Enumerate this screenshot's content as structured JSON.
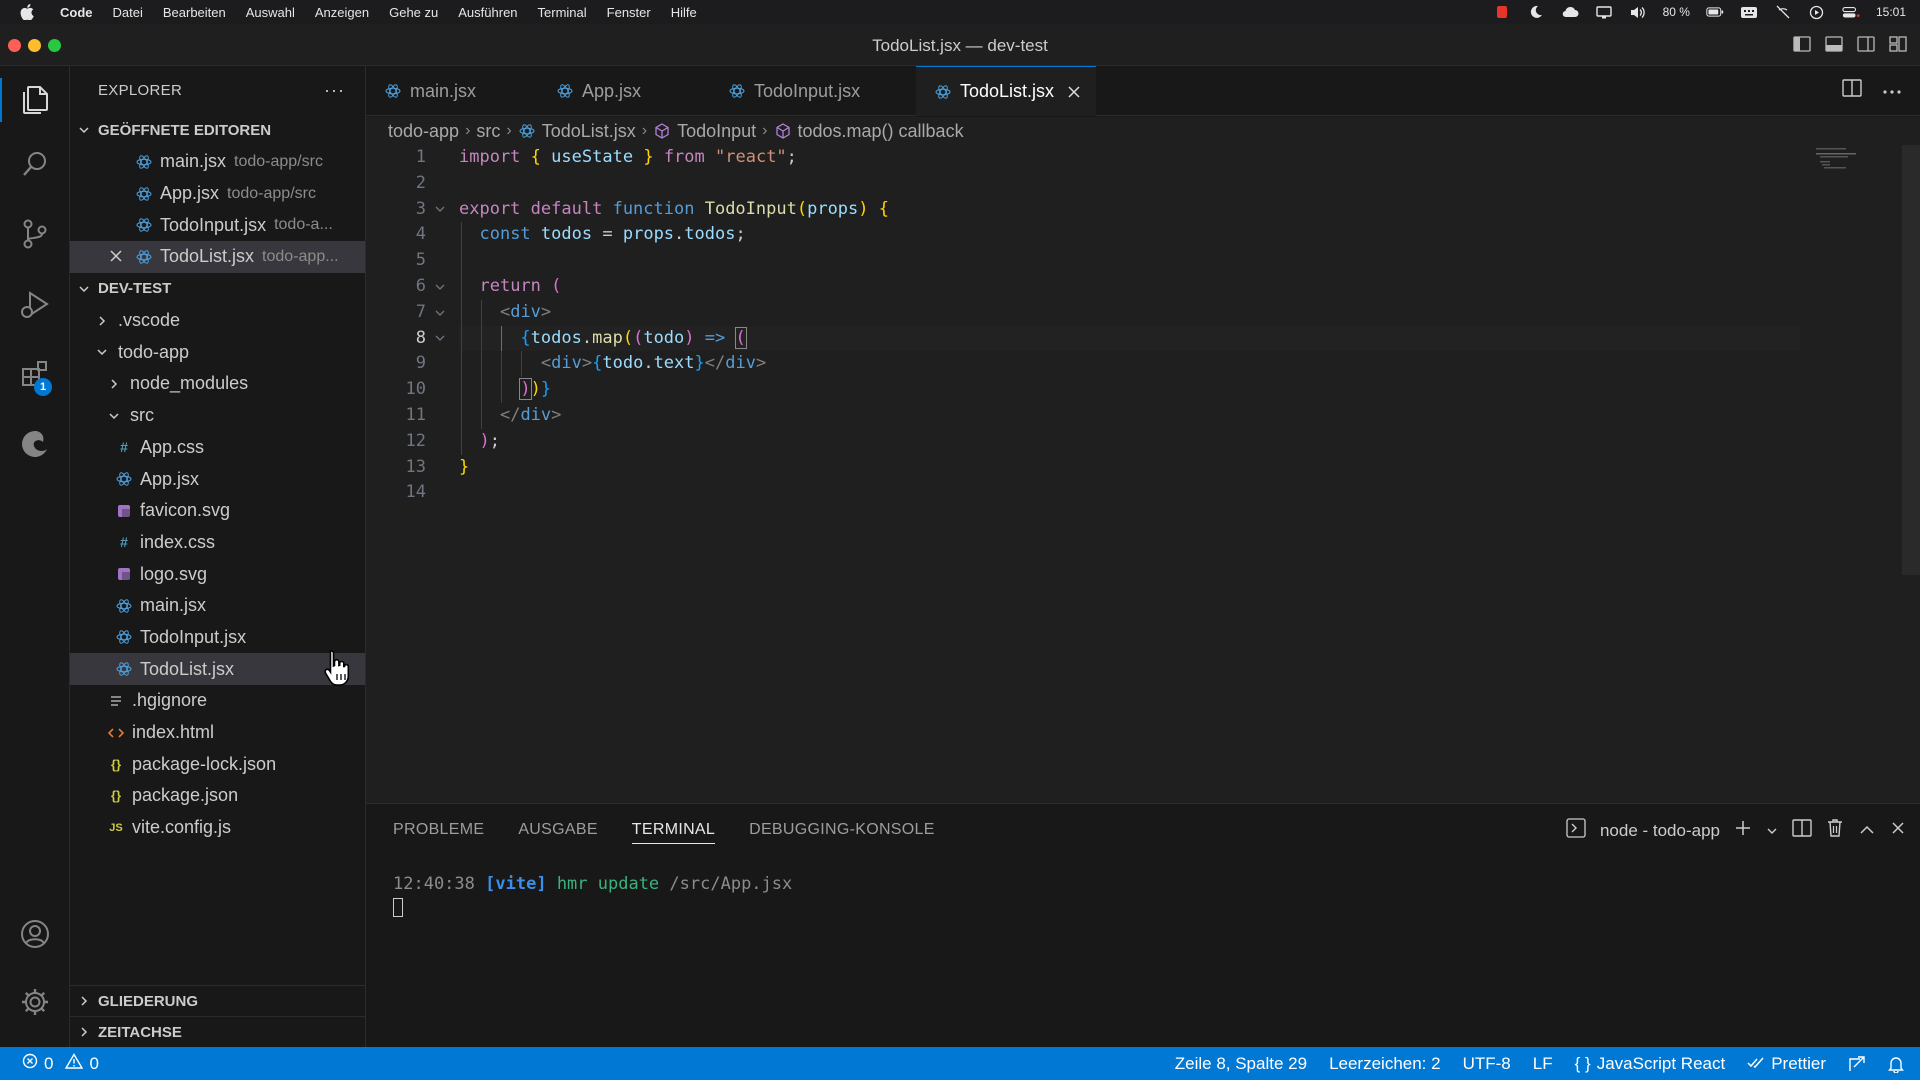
{
  "menubar": {
    "items": [
      "Code",
      "Datei",
      "Bearbeiten",
      "Auswahl",
      "Anzeigen",
      "Gehe zu",
      "Ausführen",
      "Terminal",
      "Fenster",
      "Hilfe"
    ],
    "battery": "80 %",
    "time": "15:01"
  },
  "window": {
    "title": "TodoList.jsx — dev-test"
  },
  "activity": {
    "extensions_badge": "1"
  },
  "sidebar": {
    "title": "EXPLORER",
    "more": "···",
    "open_editors": {
      "label": "GEÖFFNETE EDITOREN",
      "items": [
        {
          "name": "main.jsx",
          "path": "todo-app/src"
        },
        {
          "name": "App.jsx",
          "path": "todo-app/src"
        },
        {
          "name": "TodoInput.jsx",
          "path": "todo-a..."
        },
        {
          "name": "TodoList.jsx",
          "path": "todo-app..."
        }
      ]
    },
    "workspace": {
      "label": "DEV-TEST",
      "items": {
        "vscode": ".vscode",
        "todo_app": "todo-app",
        "node_modules": "node_modules",
        "src": "src",
        "app_css": "App.css",
        "app_jsx": "App.jsx",
        "favicon": "favicon.svg",
        "index_css": "index.css",
        "logo": "logo.svg",
        "main": "main.jsx",
        "todoinput": "TodoInput.jsx",
        "todolist": "TodoList.jsx",
        "hgignore": ".hgignore",
        "index_html": "index.html",
        "package_lock": "package-lock.json",
        "package": "package.json",
        "vite_config": "vite.config.js"
      }
    },
    "outline": "GLIEDERUNG",
    "timeline": "ZEITACHSE"
  },
  "tabs": [
    "main.jsx",
    "App.jsx",
    "TodoInput.jsx",
    "TodoList.jsx"
  ],
  "breadcrumb": [
    "todo-app",
    "src",
    "TodoList.jsx",
    "TodoInput",
    "todos.map() callback"
  ],
  "editor": {
    "line_numbers": [
      "1",
      "2",
      "3",
      "4",
      "5",
      "6",
      "7",
      "8",
      "9",
      "10",
      "11",
      "12",
      "13",
      "14"
    ],
    "tokens": {
      "import": "import",
      "lbrace": "{",
      "useState": "useState",
      "rbrace": "}",
      "from": "from",
      "react": "\"react\"",
      "semi": ";",
      "export": "export",
      "default": "default",
      "function": "function",
      "TodoInput": "TodoInput",
      "lparen": "(",
      "props": "props",
      "rparen": ")",
      "const": "const",
      "todos": "todos",
      "eq": "=",
      "dot": ".",
      "return": "return",
      "div_open": "div",
      "lt": "<",
      "gt": ">",
      "lt_slash": "</",
      "map": "map",
      "todo": "todo",
      "arrow": "=>",
      "text": "text"
    }
  },
  "panel": {
    "tabs": [
      "PROBLEME",
      "AUSGABE",
      "TERMINAL",
      "DEBUGGING-KONSOLE"
    ],
    "terminal_name": "node - todo-app",
    "terminal_line": {
      "time": "12:40:38",
      "tag": "[vite]",
      "msg": "hmr update",
      "path": "/src/App.jsx"
    }
  },
  "status": {
    "errors": "0",
    "warnings": "0",
    "position": "Zeile 8, Spalte 29",
    "indent": "Leerzeichen: 2",
    "encoding": "UTF-8",
    "eol": "LF",
    "language": "JavaScript React",
    "formatter": "Prettier"
  },
  "colors": {
    "accent": "#0078d4",
    "background": "#1f1f1f",
    "sidebar": "#181818"
  }
}
